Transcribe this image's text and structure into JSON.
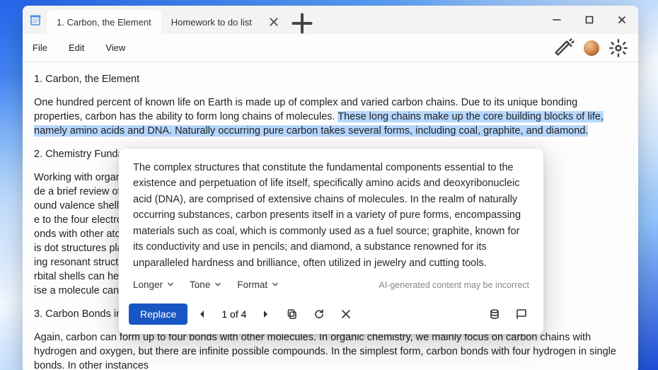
{
  "tabs": [
    {
      "label": "1. Carbon, the Element",
      "active": true
    },
    {
      "label": "Homework to do list",
      "active": false
    }
  ],
  "menu": {
    "file": "File",
    "edit": "Edit",
    "view": "View"
  },
  "doc": {
    "h1": "1. Carbon, the Element",
    "p1a": "One hundred percent of known life on Earth is made up of complex and varied carbon chains. Due to its unique bonding properties, carbon has the ability to form long chains of molecules. ",
    "p1b": "These long chains make up the core building blocks of life, namely amino acids and DNA. Naturally occurring pure carbon takes several forms, including coal, graphite, and diamond.",
    "h2": "2. Chemistry Fundan",
    "p2": "Working with organi                                                                                                                                                                                                de a brief review of valence shell theory,                                                                                                                                                                                                ound valence shell theory—the idea tha                                                                                                                                                                                                e to the four electrons in its outer                                                                                                                                                                                                onds with other atoms or molecules.                                                                                                                                                                                                is dot structures play a pivotal role in                                                                                                                                                                                                ing resonant structures) can help                                                                                                                                                                                                rbital shells can help illuminate the event                                                                                                                                                                                                ise a molecule can tell us its basic shap",
    "h3": "3. Carbon Bonds in C",
    "p3": "Again, carbon can form up to four bonds with other molecules. In organic chemistry, we mainly focus on carbon chains with hydrogen and oxygen, but there are infinite possible compounds. In the simplest form, carbon bonds with four hydrogen in single bonds. In other instances"
  },
  "ai": {
    "suggestion": "The complex structures that constitute the fundamental components essential to the existence and perpetuation of life itself, specifically amino acids and deoxyribonucleic acid (DNA), are comprised of extensive chains of molecules. In the realm of naturally occurring substances, carbon presents itself in a variety of pure forms, encompassing materials such as coal, which is commonly used as a fuel source; graphite, known for its conductivity and use in pencils; and diamond, a substance renowned for its unparalleled hardness and brilliance, often utilized in jewelry and cutting tools.",
    "opt_longer": "Longer",
    "opt_tone": "Tone",
    "opt_format": "Format",
    "disclaimer": "AI-generated content may be incorrect",
    "replace": "Replace",
    "pager": "1 of 4"
  }
}
